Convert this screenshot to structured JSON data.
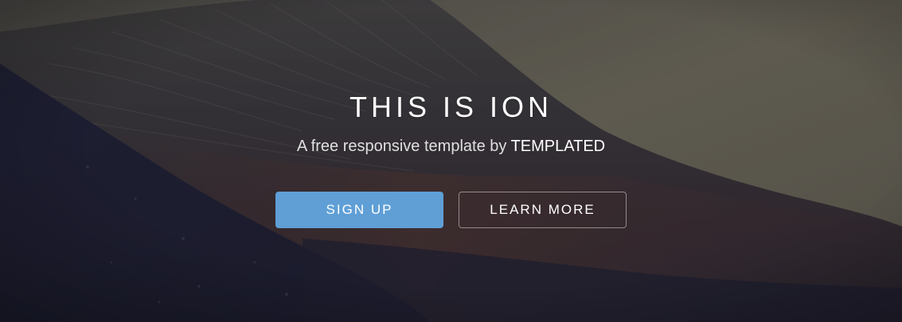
{
  "banner": {
    "title": "THIS IS ION",
    "subtitle_prefix": "A free responsive template by ",
    "subtitle_brand": "TEMPLATED",
    "primary_button_label": "SIGN UP",
    "secondary_button_label": "LEARN MORE"
  },
  "colors": {
    "primary_button": "#5f9fd6",
    "text": "#ffffff",
    "sky": "#7a7460",
    "mountain_dark": "#26273a"
  },
  "background": {
    "subject": "mountain-landscape-photo"
  }
}
